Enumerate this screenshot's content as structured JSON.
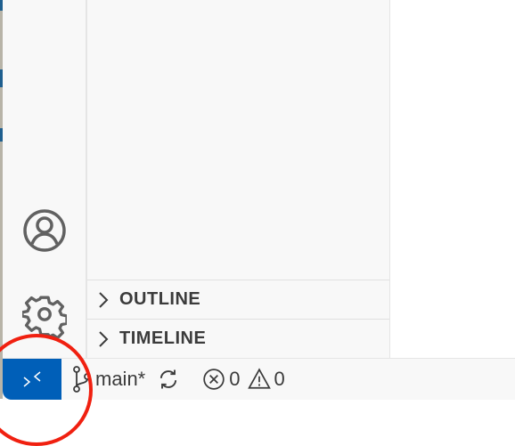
{
  "sidebar": {
    "sections": [
      {
        "label": "OUTLINE",
        "expanded": false
      },
      {
        "label": "TIMELINE",
        "expanded": false
      }
    ]
  },
  "activity_bar": {
    "icons": [
      "account-icon",
      "gear-icon"
    ]
  },
  "status_bar": {
    "branch": "main*",
    "errors": "0",
    "warnings": "0",
    "remote_color": "#005fb8"
  },
  "annotation": {
    "color": "#f02010",
    "shape": "circle",
    "target": "remote-button"
  }
}
